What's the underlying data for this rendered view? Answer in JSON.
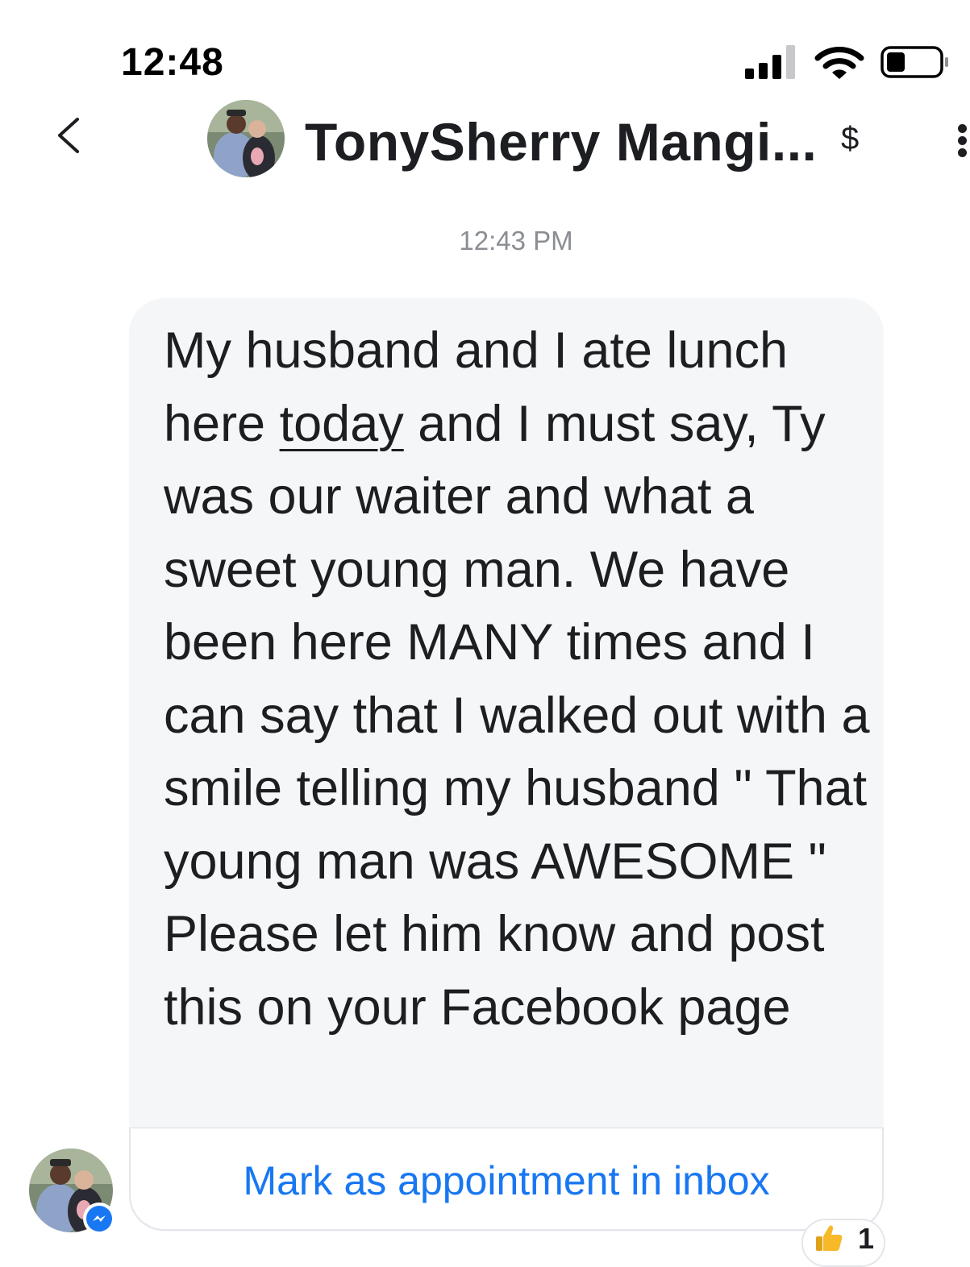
{
  "status_bar": {
    "time": "12:48",
    "signal_icon": "cellular-signal-icon",
    "wifi_icon": "wifi-icon",
    "battery_icon": "battery-icon",
    "battery_level": 0.3
  },
  "header": {
    "back_icon": "chevron-left-icon",
    "contact_name": "TonySherry Mangi...",
    "payment_symbol": "$",
    "more_icon": "more-vertical-icon"
  },
  "conversation": {
    "timestamp": "12:43 PM",
    "message": {
      "text_before_link": "My husband and I ate lunch here ",
      "link_text": "today",
      "text_after_link": " and I must say, Ty was our waiter and what a sweet young man. We have been here MANY times and I can say that I walked out with a smile telling my husband \" That young man was AWESOME \"   Please let him know and post this on your Facebook page",
      "action_label": "Mark as appointment in inbox",
      "reaction": {
        "icon": "thumbs-up-icon",
        "count": "1"
      }
    }
  },
  "colors": {
    "accent": "#1877f2",
    "bubble_background": "#f5f6f8",
    "muted_text": "#8a8d91",
    "reaction_yellow": "#f7b928"
  }
}
